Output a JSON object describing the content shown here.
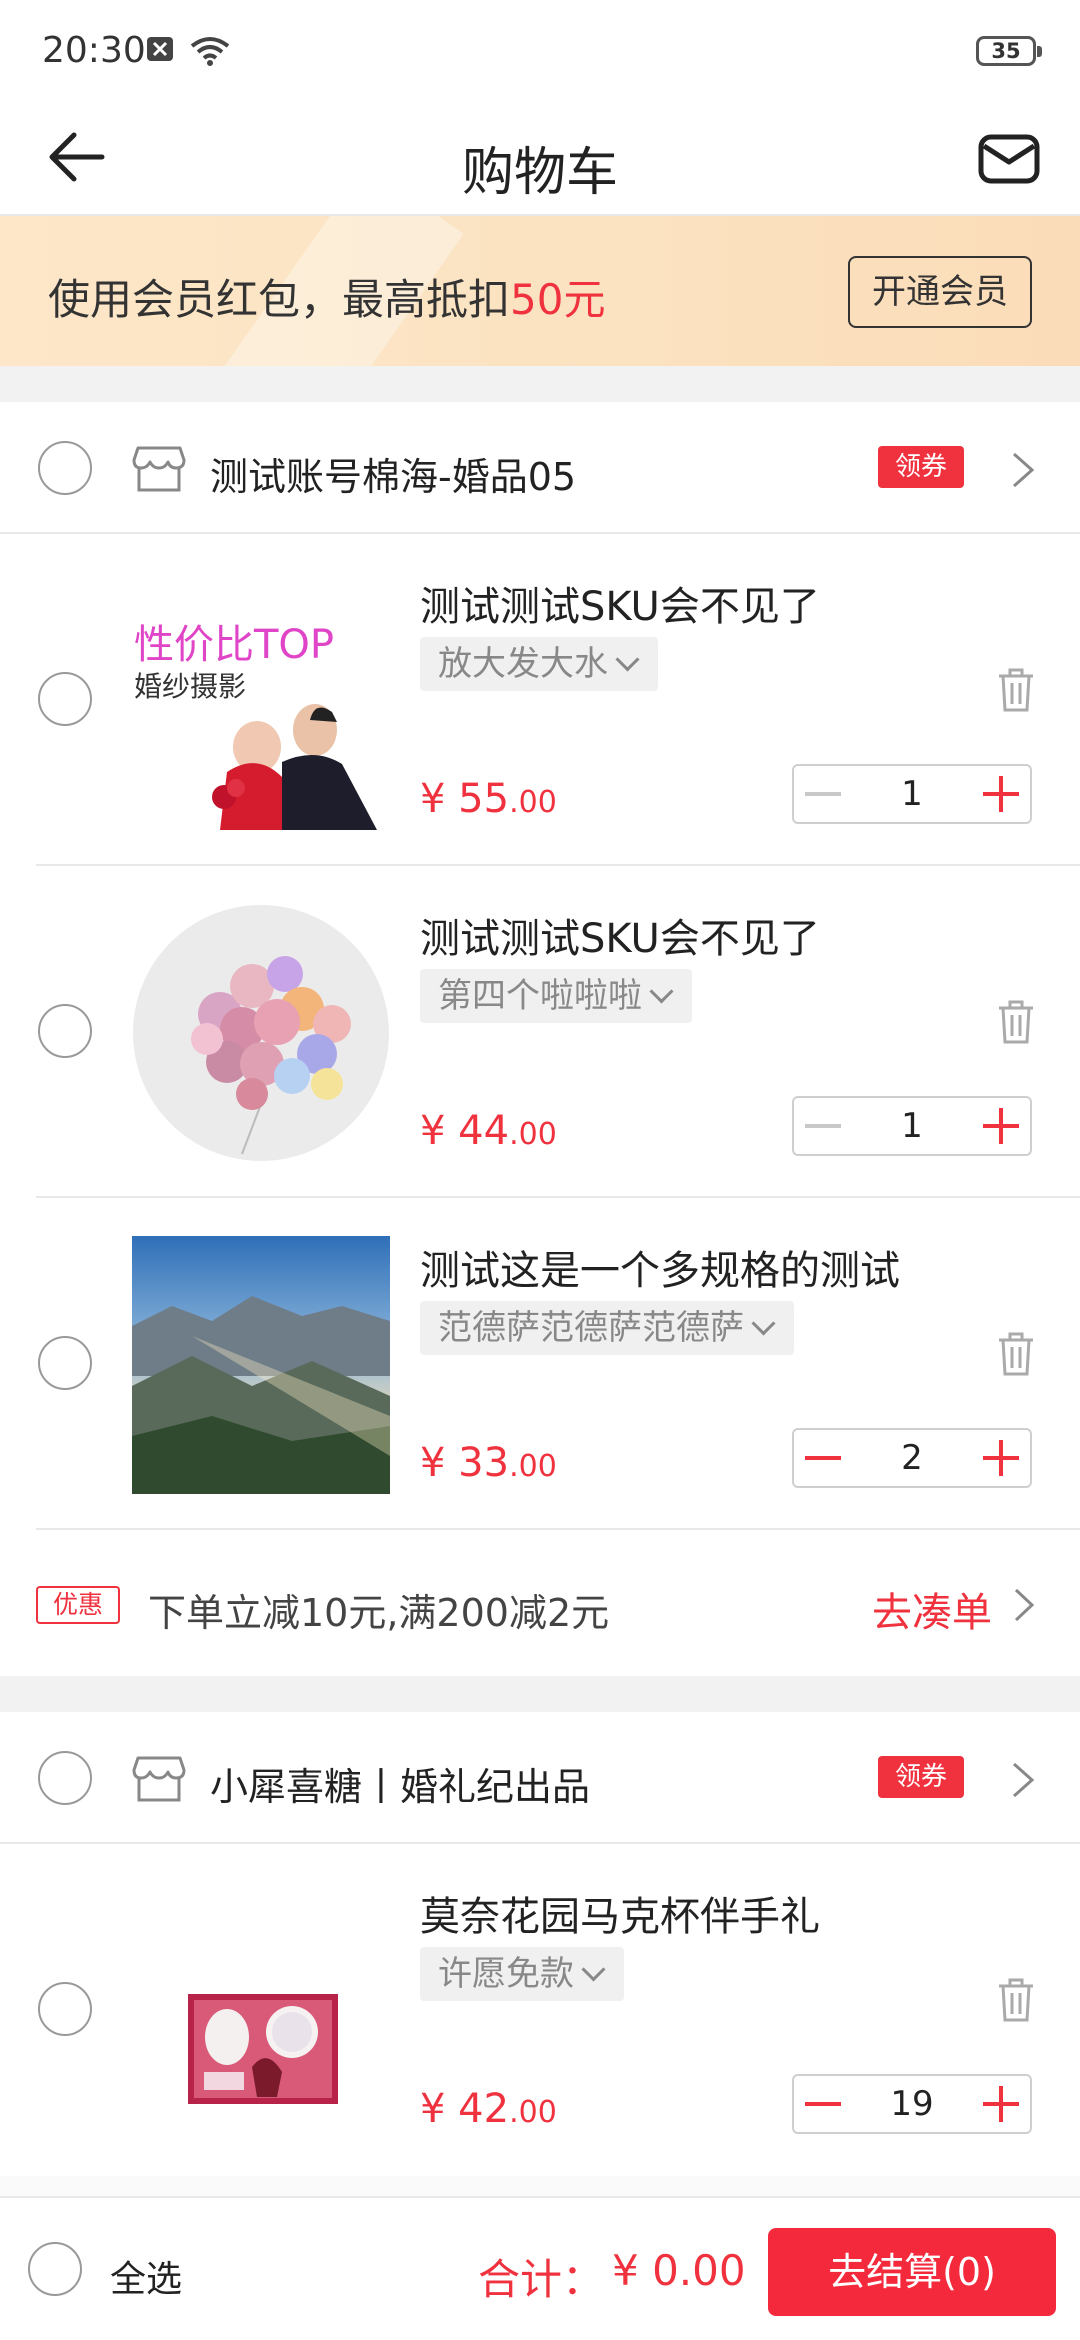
{
  "status_bar": {
    "time": "20:30",
    "battery": "35"
  },
  "header": {
    "title": "购物车"
  },
  "banner": {
    "text": "使用会员红包，最高抵扣",
    "amount": "50元",
    "button": "开通会员"
  },
  "shops": [
    {
      "name": "测试账号棉海-婚品05",
      "coupon": "领券"
    },
    {
      "name": "小犀喜糖丨婚礼纪出品",
      "coupon": "领券"
    }
  ],
  "items": [
    {
      "title": "测试测试SKU会不见了",
      "sku": "放大发大水",
      "price_symbol": "¥ ",
      "price_int": "55",
      "price_dec": ".00",
      "qty": "1",
      "image": {
        "kind": "wedding-photo",
        "line1": "性价比TOP",
        "line2": "婚纱摄影"
      }
    },
    {
      "title": "测试测试SKU会不见了",
      "sku": "第四个啦啦啦",
      "price_symbol": "¥ ",
      "price_int": "44",
      "price_dec": ".00",
      "qty": "1",
      "image": {
        "kind": "balloons"
      }
    },
    {
      "title": "测试这是一个多规格的测试",
      "sku": "范德萨范德萨范德萨",
      "price_symbol": "¥ ",
      "price_int": "33",
      "price_dec": ".00",
      "qty": "2",
      "image": {
        "kind": "mountain-landscape"
      }
    },
    {
      "title": "莫奈花园马克杯伴手礼",
      "sku": "许愿免款",
      "price_symbol": "¥ ",
      "price_int": "42",
      "price_dec": ".00",
      "qty": "19",
      "image": {
        "kind": "gift-box"
      }
    }
  ],
  "promo": {
    "tag": "优惠",
    "text": "下单立减10元,满200减2元",
    "link": "去凑单"
  },
  "bottom": {
    "select_all": "全选",
    "total_label": "合计：",
    "total_value": "¥ 0.00",
    "checkout": "去结算(0)"
  },
  "colors": {
    "accent": "#f0323f",
    "banner_bg": "#fde7c8",
    "gap_bg": "#f2f2f2"
  }
}
